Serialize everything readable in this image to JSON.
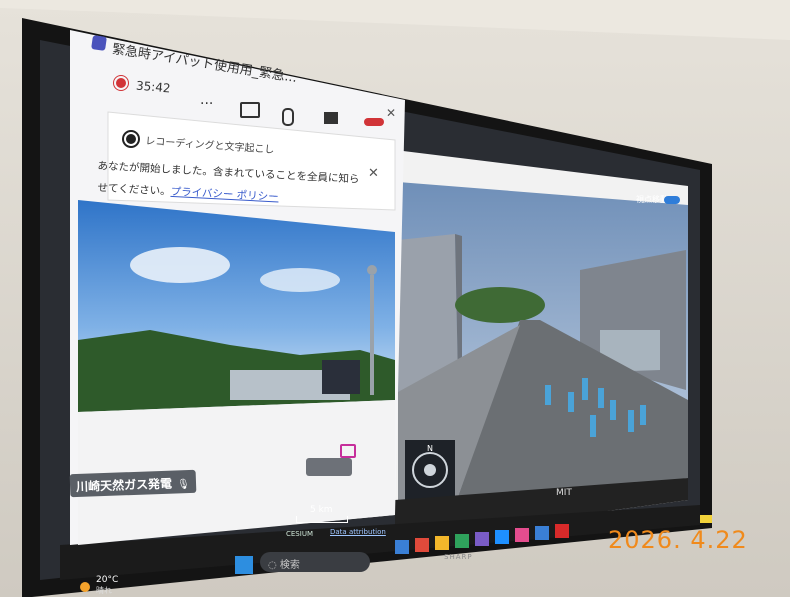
{
  "teams_window": {
    "title": "緊急時アイパット使用用_緊急...",
    "recording_time": "35:42",
    "more_label": "...",
    "banner_heading": "レコーディングと文字起こし",
    "banner_body_line1": "あなたが開始しました。含まれていることを全員に知ら",
    "banner_body_line2": "せてください。",
    "privacy_link": "プライバシー ポリシー",
    "participant_name": "川崎天然ガス発電"
  },
  "map_viewer": {
    "top_label": "視点移動",
    "scale_label": "5 km",
    "attribution_label": "Data attribution",
    "cesium_label": "CESIUM",
    "compass_north": "N",
    "bottom_center_label": "MIT"
  },
  "taskbar": {
    "search_placeholder": "検索",
    "weather_temp": "20°C",
    "weather_desc": "晴れ"
  },
  "monitor": {
    "brand": "SHARP"
  },
  "photo": {
    "date_stamp": "2026. 4.22"
  },
  "colors": {
    "teams_accent": "#4b53bc",
    "record_red": "#d13438",
    "date_stamp_orange": "#f08a1c",
    "bezel": "#141414"
  }
}
